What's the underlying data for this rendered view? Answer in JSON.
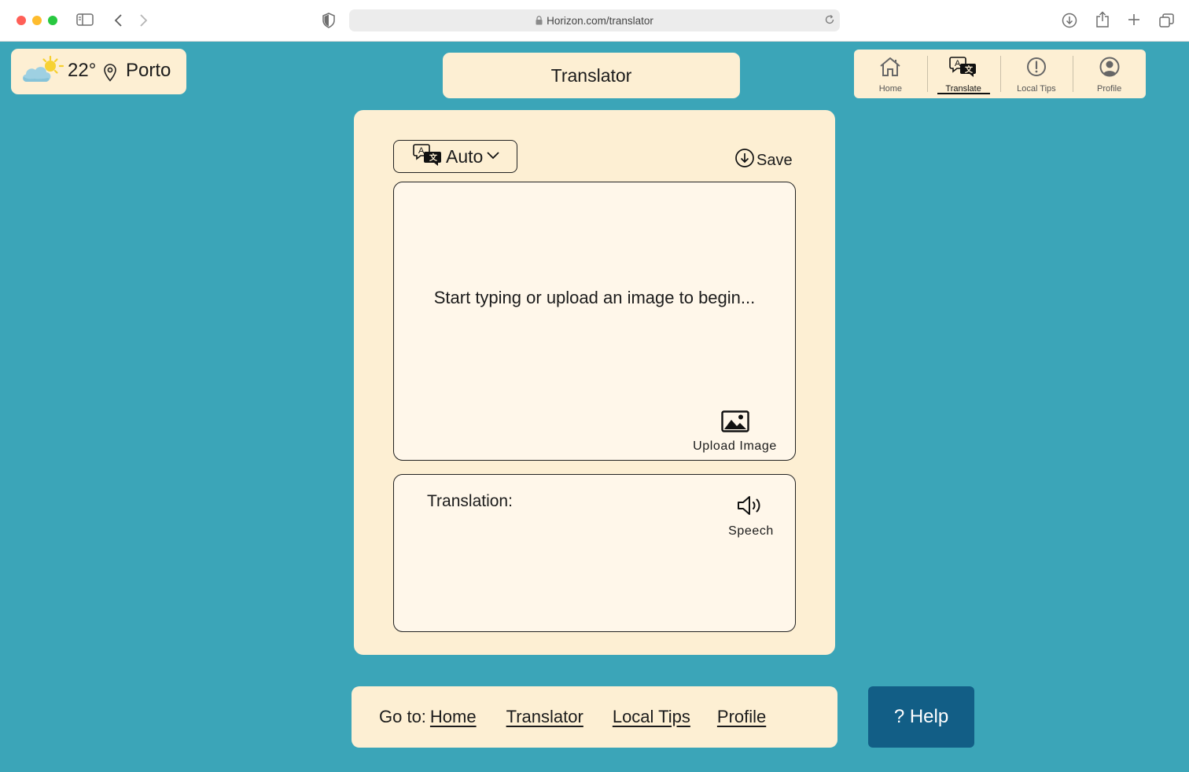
{
  "browser": {
    "url": "Horizon.com/translator"
  },
  "weather": {
    "temperature": "22°",
    "city": "Porto",
    "icon": "partly-sunny-icon"
  },
  "header": {
    "title": "Translator"
  },
  "topnav": {
    "items": [
      {
        "label": "Home",
        "icon": "home-icon"
      },
      {
        "label": "Translate",
        "icon": "translate-icon",
        "active": true
      },
      {
        "label": "Local Tips",
        "icon": "alert-circle-icon"
      },
      {
        "label": "Profile",
        "icon": "user-circle-icon"
      }
    ]
  },
  "translator": {
    "source_language": "Auto",
    "save_label": "Save",
    "input_placeholder": "Start typing or upload an image to begin...",
    "upload_label": "Upload Image",
    "output_label": "Translation:",
    "speech_label": "Speech"
  },
  "footer": {
    "prefix": "Go to:",
    "links": [
      "Home",
      "Translator",
      "Local Tips",
      "Profile"
    ]
  },
  "help": {
    "label": "? Help"
  },
  "colors": {
    "background": "#3ba5b8",
    "card": "#fdefd3",
    "help_button": "#125e86"
  }
}
